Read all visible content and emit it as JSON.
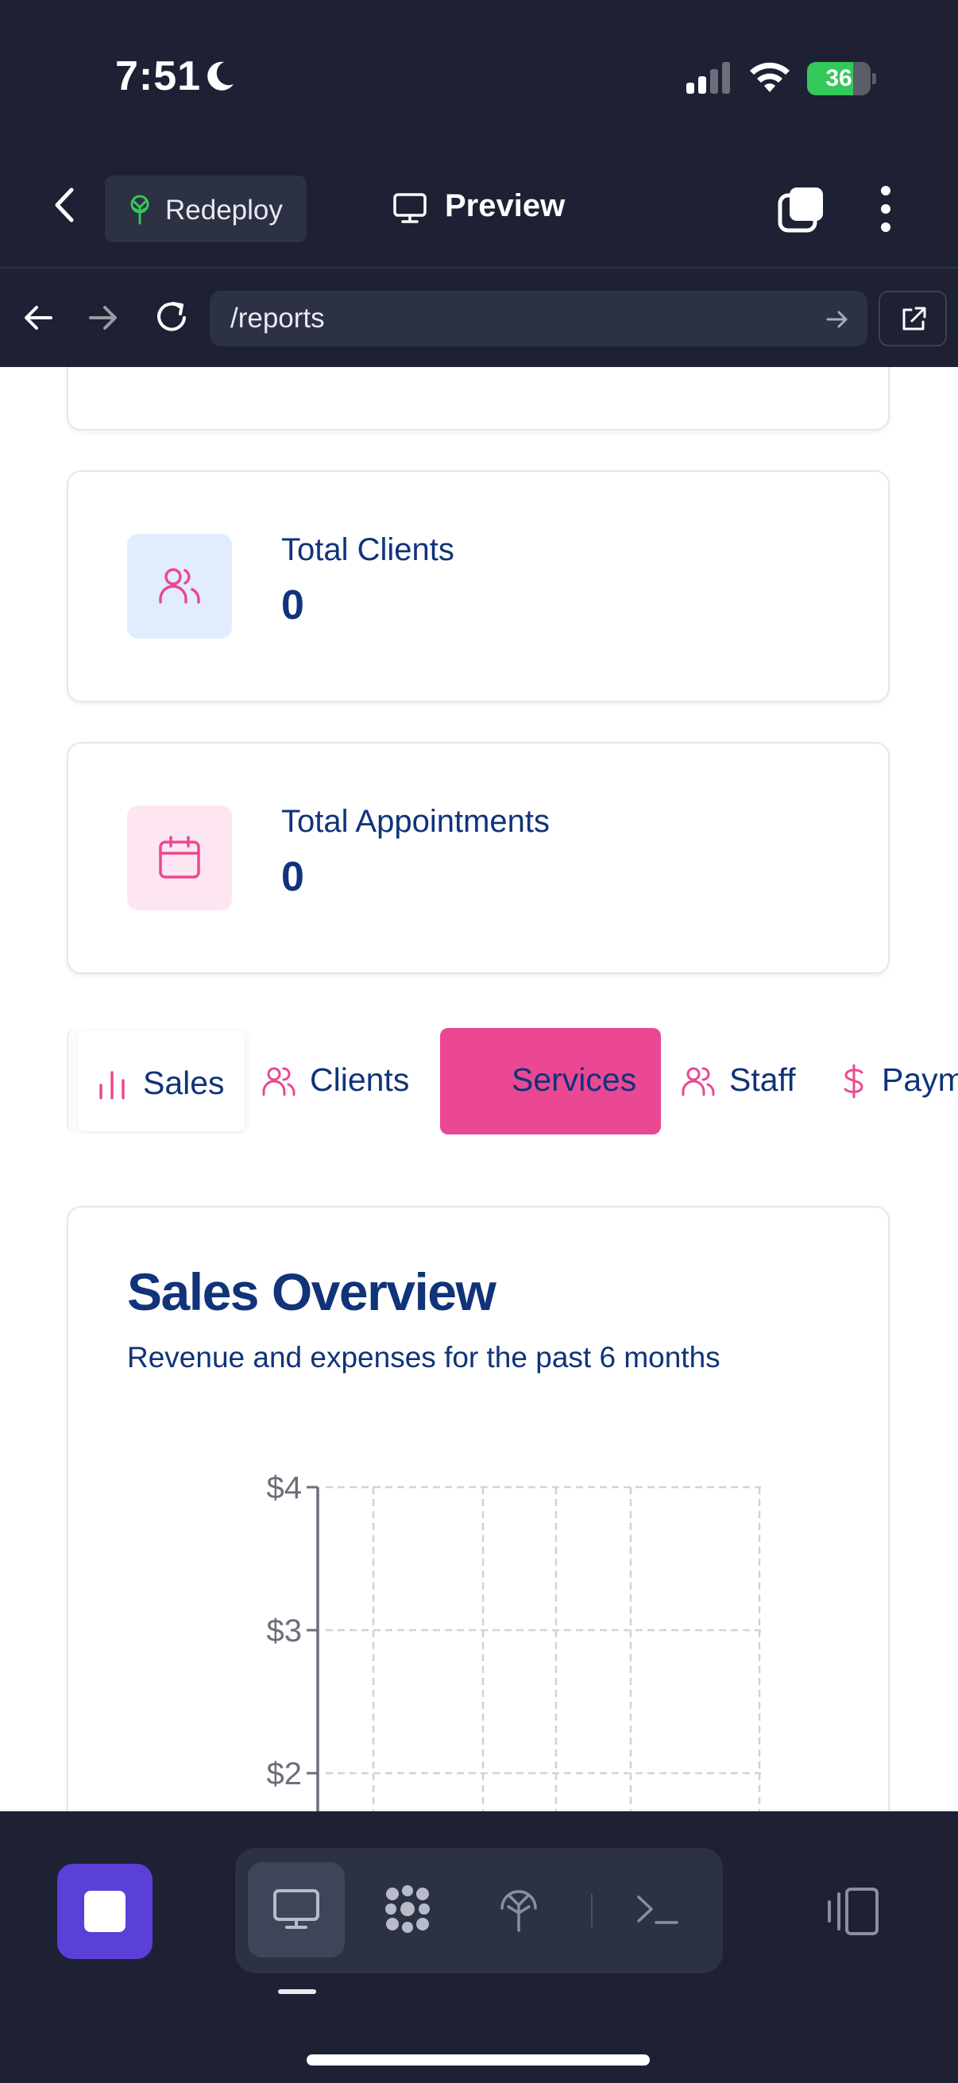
{
  "status_bar": {
    "time": "7:51",
    "battery": "36"
  },
  "header": {
    "redeploy_label": "Redeploy",
    "preview_label": "Preview"
  },
  "url_bar": {
    "path": "/reports"
  },
  "stats": [
    {
      "label": "Total Clients",
      "value": "0",
      "icon": "users-icon"
    },
    {
      "label": "Total Appointments",
      "value": "0",
      "icon": "calendar-icon"
    }
  ],
  "tabs": [
    {
      "label": "Sales",
      "icon": "bar-chart-icon",
      "selected": true
    },
    {
      "label": "Clients",
      "icon": "users-icon"
    },
    {
      "label": "Services",
      "icon": "none",
      "highlighted": true
    },
    {
      "label": "Staff",
      "icon": "users-icon"
    },
    {
      "label": "Payments",
      "icon": "dollar-icon"
    }
  ],
  "sales_overview": {
    "title": "Sales Overview",
    "subtitle": "Revenue and expenses for the past 6 months"
  },
  "chart_data": {
    "type": "bar",
    "title": "",
    "y_ticks": [
      "$4",
      "$3",
      "$2"
    ],
    "ylim": [
      0,
      4
    ],
    "grid": true,
    "categories": [],
    "series": []
  },
  "colors": {
    "accent_pink": "#ea4893",
    "navy_text": "#10337a",
    "dark_bg": "#1d2133",
    "stop_purple": "#5a3fd8",
    "clients_icon_bg": "#e1ecfd",
    "appts_icon_bg": "#fde6f1"
  },
  "dock": {
    "items": [
      "desktop-icon",
      "grid-icon",
      "deploy-icon",
      "terminal-icon"
    ]
  }
}
